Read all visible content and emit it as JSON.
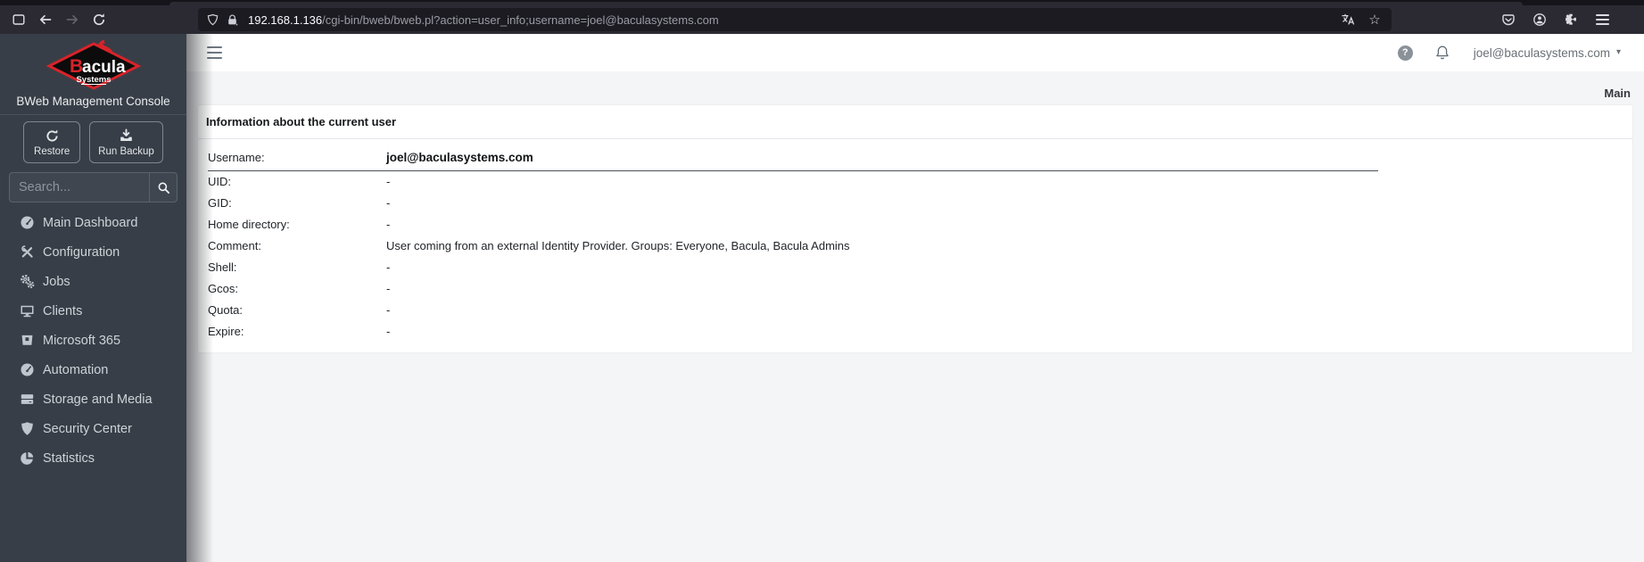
{
  "browser": {
    "url": {
      "host": "192.168.1.136",
      "path": "/cgi-bin/bweb/bweb.pl?action=user_info;username=joel@baculasystems.com"
    },
    "glyphs": {
      "star": "☆"
    }
  },
  "sidebar": {
    "logo": {
      "brand_initial": "B",
      "brand_rest": "acula",
      "brand_sub": "Systems"
    },
    "console_title": "BWeb Management Console",
    "actions": {
      "restore": "Restore",
      "run_backup": "Run Backup"
    },
    "search": {
      "placeholder": "Search..."
    },
    "items": [
      {
        "label": "Main Dashboard",
        "icon": "dashboard-icon"
      },
      {
        "label": "Configuration",
        "icon": "tools-icon"
      },
      {
        "label": "Jobs",
        "icon": "gears-icon"
      },
      {
        "label": "Clients",
        "icon": "desktop-icon"
      },
      {
        "label": "Microsoft 365",
        "icon": "m365-icon"
      },
      {
        "label": "Automation",
        "icon": "gauge-icon"
      },
      {
        "label": "Storage and Media",
        "icon": "server-icon"
      },
      {
        "label": "Security Center",
        "icon": "shield-icon"
      },
      {
        "label": "Statistics",
        "icon": "pie-chart-icon"
      }
    ]
  },
  "header": {
    "help_glyph": "?",
    "caret_glyph": "▾",
    "user_email": "joel@baculasystems.com"
  },
  "main": {
    "breadcrumb": "Main",
    "panel": {
      "title": "Information about the current user",
      "rows": [
        {
          "label": "Username:",
          "value": "joel@baculasystems.com"
        },
        {
          "label": "UID:",
          "value": "-"
        },
        {
          "label": "GID:",
          "value": "-"
        },
        {
          "label": "Home directory:",
          "value": "-"
        },
        {
          "label": "Comment:",
          "value": "User coming from an external Identity Provider. Groups: Everyone, Bacula, Bacula Admins"
        },
        {
          "label": "Shell:",
          "value": "-"
        },
        {
          "label": "Gcos:",
          "value": "-"
        },
        {
          "label": "Quota:",
          "value": "-"
        },
        {
          "label": "Expire:",
          "value": "-"
        }
      ]
    }
  },
  "colors": {
    "accent_red": "#d8232a",
    "sidebar_bg": "#383e47",
    "content_bg": "#f4f5f7",
    "chrome_bg": "#2b2a33",
    "chrome_dark": "#1c1b22"
  }
}
